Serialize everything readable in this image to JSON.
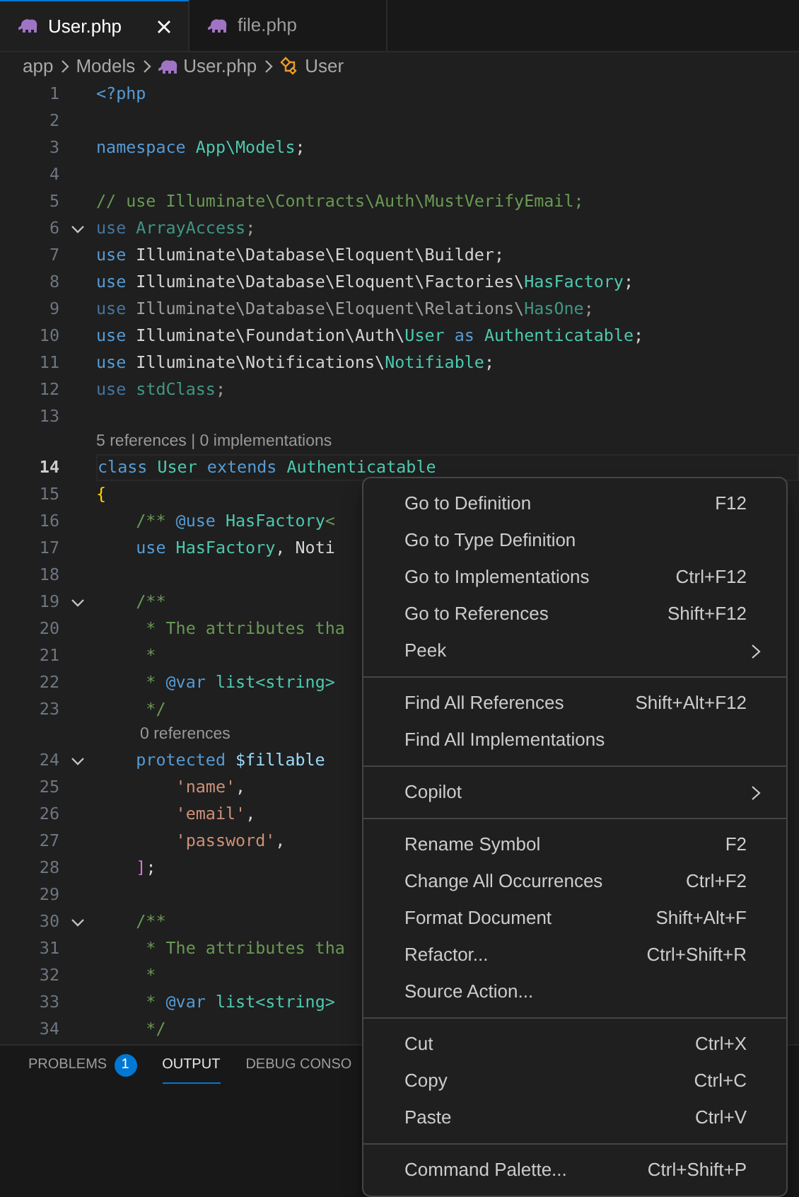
{
  "tabs": [
    {
      "label": "User.php",
      "selected": true,
      "closable": true
    },
    {
      "label": "file.php",
      "selected": false,
      "closable": false
    }
  ],
  "breadcrumb": [
    {
      "label": "app",
      "kind": "folder"
    },
    {
      "label": "Models",
      "kind": "folder"
    },
    {
      "label": "User.php",
      "kind": "file"
    },
    {
      "label": "User",
      "kind": "class"
    }
  ],
  "editor": {
    "lines": [
      {
        "kind": "code",
        "number": "1",
        "tokens": [
          {
            "kind": "keyword",
            "text": "<?php"
          }
        ]
      },
      {
        "kind": "code",
        "number": "2"
      },
      {
        "kind": "code",
        "number": "3",
        "tokens": [
          {
            "kind": "keyword",
            "text": "namespace "
          },
          {
            "kind": "type",
            "text": "App\\Models"
          },
          {
            "kind": "plain",
            "text": ";"
          }
        ]
      },
      {
        "kind": "code",
        "number": "4"
      },
      {
        "kind": "code",
        "number": "5",
        "tokens": [
          {
            "kind": "comment",
            "text": "// use Illuminate\\Contracts\\Auth\\MustVerifyEmail;"
          }
        ]
      },
      {
        "kind": "code",
        "number": "6",
        "foldable": true,
        "faded": true,
        "tokens": [
          {
            "kind": "keyword",
            "text": "use "
          },
          {
            "kind": "type",
            "text": "ArrayAccess"
          },
          {
            "kind": "plain",
            "text": ";"
          }
        ]
      },
      {
        "kind": "code",
        "number": "7",
        "tokens": [
          {
            "kind": "keyword",
            "text": "use "
          },
          {
            "kind": "plain",
            "text": "Illuminate\\Database\\Eloquent\\Builder;"
          }
        ]
      },
      {
        "kind": "code",
        "number": "8",
        "tokens": [
          {
            "kind": "keyword",
            "text": "use "
          },
          {
            "kind": "plain",
            "text": "Illuminate\\Database\\Eloquent\\Factories\\"
          },
          {
            "kind": "type",
            "text": "HasFactory"
          },
          {
            "kind": "plain",
            "text": ";"
          }
        ]
      },
      {
        "kind": "code",
        "number": "9",
        "faded": true,
        "tokens": [
          {
            "kind": "keyword",
            "text": "use "
          },
          {
            "kind": "plain",
            "text": "Illuminate\\Database\\Eloquent\\Relations\\"
          },
          {
            "kind": "type",
            "text": "HasOne"
          },
          {
            "kind": "plain",
            "text": ";"
          }
        ]
      },
      {
        "kind": "code",
        "number": "10",
        "tokens": [
          {
            "kind": "keyword",
            "text": "use "
          },
          {
            "kind": "plain",
            "text": "Illuminate\\Foundation\\Auth\\"
          },
          {
            "kind": "type",
            "text": "User"
          },
          {
            "kind": "keyword",
            "text": " as "
          },
          {
            "kind": "type",
            "text": "Authenticatable"
          },
          {
            "kind": "plain",
            "text": ";"
          }
        ]
      },
      {
        "kind": "code",
        "number": "11",
        "tokens": [
          {
            "kind": "keyword",
            "text": "use "
          },
          {
            "kind": "plain",
            "text": "Illuminate\\Notifications\\"
          },
          {
            "kind": "type",
            "text": "Notifiable"
          },
          {
            "kind": "plain",
            "text": ";"
          }
        ]
      },
      {
        "kind": "code",
        "number": "12",
        "faded": true,
        "tokens": [
          {
            "kind": "keyword",
            "text": "use "
          },
          {
            "kind": "type",
            "text": "stdClass"
          },
          {
            "kind": "plain",
            "text": ";"
          }
        ]
      },
      {
        "kind": "code",
        "number": "13"
      },
      {
        "kind": "codelens",
        "text": "5 references | 0 implementations"
      },
      {
        "kind": "code",
        "number": "14",
        "current": true,
        "tokens": [
          {
            "kind": "keyword",
            "text": "class "
          },
          {
            "kind": "type",
            "text": "User "
          },
          {
            "kind": "keyword",
            "text": "extends "
          },
          {
            "kind": "type",
            "text": "Authenticatable"
          }
        ]
      },
      {
        "kind": "code",
        "number": "15",
        "tokens": [
          {
            "kind": "bracket",
            "text": "{"
          }
        ]
      },
      {
        "kind": "code",
        "number": "16",
        "tokens": [
          {
            "kind": "comment",
            "text": "    /** "
          },
          {
            "kind": "keyword",
            "text": "@use "
          },
          {
            "kind": "type",
            "text": "HasFactory"
          },
          {
            "kind": "comment",
            "text": "<"
          }
        ]
      },
      {
        "kind": "code",
        "number": "17",
        "tokens": [
          {
            "kind": "keyword",
            "text": "    use "
          },
          {
            "kind": "type",
            "text": "HasFactory"
          },
          {
            "kind": "plain",
            "text": ", Noti"
          }
        ]
      },
      {
        "kind": "code",
        "number": "18"
      },
      {
        "kind": "code",
        "number": "19",
        "foldable": true,
        "tokens": [
          {
            "kind": "comment",
            "text": "    /**"
          }
        ]
      },
      {
        "kind": "code",
        "number": "20",
        "tokens": [
          {
            "kind": "comment",
            "text": "     * The attributes tha"
          }
        ]
      },
      {
        "kind": "code",
        "number": "21",
        "tokens": [
          {
            "kind": "comment",
            "text": "     *"
          }
        ]
      },
      {
        "kind": "code",
        "number": "22",
        "tokens": [
          {
            "kind": "comment",
            "text": "     * "
          },
          {
            "kind": "keyword",
            "text": "@var "
          },
          {
            "kind": "type",
            "text": "list<string>"
          }
        ]
      },
      {
        "kind": "code",
        "number": "23",
        "tokens": [
          {
            "kind": "comment",
            "text": "     */"
          }
        ]
      },
      {
        "kind": "codelens",
        "text": "0 references",
        "indent": true
      },
      {
        "kind": "code",
        "number": "24",
        "foldable": true,
        "tokens": [
          {
            "kind": "keyword",
            "text": "    protected "
          },
          {
            "kind": "variable",
            "text": "$fillable"
          }
        ]
      },
      {
        "kind": "code",
        "number": "25",
        "tokens": [
          {
            "kind": "string",
            "text": "        'name'"
          },
          {
            "kind": "plain",
            "text": ","
          }
        ]
      },
      {
        "kind": "code",
        "number": "26",
        "tokens": [
          {
            "kind": "string",
            "text": "        'email'"
          },
          {
            "kind": "plain",
            "text": ","
          }
        ]
      },
      {
        "kind": "code",
        "number": "27",
        "tokens": [
          {
            "kind": "string",
            "text": "        'password'"
          },
          {
            "kind": "plain",
            "text": ","
          }
        ]
      },
      {
        "kind": "code",
        "number": "28",
        "tokens": [
          {
            "kind": "bracket2",
            "text": "    ]"
          },
          {
            "kind": "plain",
            "text": ";"
          }
        ]
      },
      {
        "kind": "code",
        "number": "29"
      },
      {
        "kind": "code",
        "number": "30",
        "foldable": true,
        "tokens": [
          {
            "kind": "comment",
            "text": "    /**"
          }
        ]
      },
      {
        "kind": "code",
        "number": "31",
        "tokens": [
          {
            "kind": "comment",
            "text": "     * The attributes tha"
          }
        ]
      },
      {
        "kind": "code",
        "number": "32",
        "tokens": [
          {
            "kind": "comment",
            "text": "     *"
          }
        ]
      },
      {
        "kind": "code",
        "number": "33",
        "tokens": [
          {
            "kind": "comment",
            "text": "     * "
          },
          {
            "kind": "keyword",
            "text": "@var "
          },
          {
            "kind": "type",
            "text": "list<string>"
          }
        ]
      },
      {
        "kind": "code",
        "number": "34",
        "tokens": [
          {
            "kind": "comment",
            "text": "     */"
          }
        ]
      }
    ]
  },
  "panel_tabs": [
    {
      "label": "PROBLEMS",
      "badge": "1",
      "selected": false
    },
    {
      "label": "OUTPUT",
      "selected": true
    },
    {
      "label": "DEBUG CONSO",
      "selected": false
    }
  ],
  "context_menu": [
    [
      {
        "label": "Go to Definition",
        "shortcut": "F12"
      },
      {
        "label": "Go to Type Definition"
      },
      {
        "label": "Go to Implementations",
        "shortcut": "Ctrl+F12"
      },
      {
        "label": "Go to References",
        "shortcut": "Shift+F12"
      },
      {
        "label": "Peek",
        "submenu": true
      }
    ],
    [
      {
        "label": "Find All References",
        "shortcut": "Shift+Alt+F12"
      },
      {
        "label": "Find All Implementations"
      }
    ],
    [
      {
        "label": "Copilot",
        "submenu": true
      }
    ],
    [
      {
        "label": "Rename Symbol",
        "shortcut": "F2"
      },
      {
        "label": "Change All Occurrences",
        "shortcut": "Ctrl+F2"
      },
      {
        "label": "Format Document",
        "shortcut": "Shift+Alt+F"
      },
      {
        "label": "Refactor...",
        "shortcut": "Ctrl+Shift+R"
      },
      {
        "label": "Source Action..."
      }
    ],
    [
      {
        "label": "Cut",
        "shortcut": "Ctrl+X"
      },
      {
        "label": "Copy",
        "shortcut": "Ctrl+C"
      },
      {
        "label": "Paste",
        "shortcut": "Ctrl+V"
      }
    ],
    [
      {
        "label": "Command Palette...",
        "shortcut": "Ctrl+Shift+P"
      }
    ]
  ]
}
